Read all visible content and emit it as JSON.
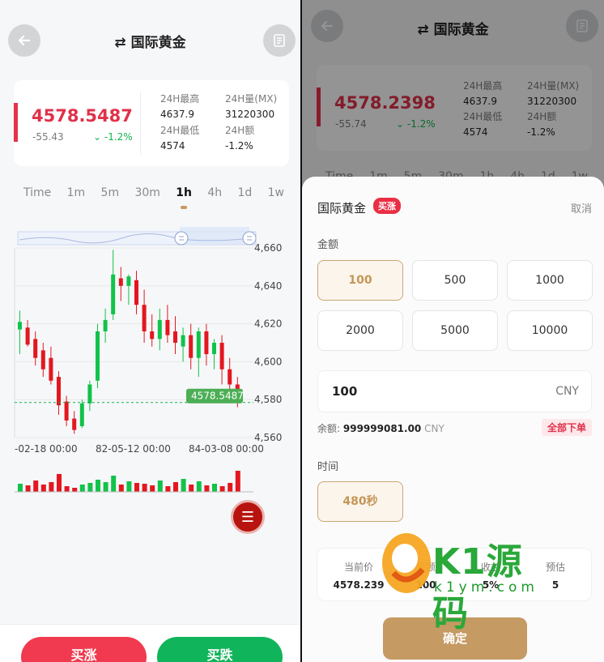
{
  "left": {
    "title": "国际黄金",
    "price": "4578.5487",
    "change": "-55.43",
    "change_pct": "-1.2%",
    "stats": [
      {
        "label": "24H最高",
        "value": "4637.9"
      },
      {
        "label": "24H量(MX)",
        "value": "31220300"
      },
      {
        "label": "24H最低",
        "value": "4574"
      },
      {
        "label": "24H额",
        "value": "-1.2%"
      }
    ],
    "timeframes": [
      "Time",
      "1m",
      "5m",
      "30m",
      "1h",
      "4h",
      "1d",
      "1w"
    ],
    "active_timeframe": "1h",
    "price_axis": [
      "4,660",
      "4,640",
      "4,620",
      "4,600",
      "4,580",
      "4,560"
    ],
    "date_axis": [
      "-02-18 00:00",
      "82-05-12 00:00",
      "84-03-08 00:00"
    ],
    "last_price_tag": "4578.5487",
    "buy_up_label": "买涨",
    "buy_down_label": "买跌"
  },
  "right": {
    "title": "国际黄金",
    "price": "4578.2398",
    "change": "-55.74",
    "change_pct": "-1.2%",
    "stats": [
      {
        "label": "24H最高",
        "value": "4637.9"
      },
      {
        "label": "24H量(MX)",
        "value": "31220300"
      },
      {
        "label": "24H最低",
        "value": "4574"
      },
      {
        "label": "24H额",
        "value": "-1.2%"
      }
    ],
    "timeframes_partial": [
      "Time",
      "1m",
      "5m",
      "30m",
      "1h",
      "4h",
      "1d",
      "1w"
    ]
  },
  "order": {
    "title": "国际黄金",
    "direction_badge": "买涨",
    "cancel_label": "取消",
    "amount_label": "金额",
    "amount_options": [
      "100",
      "500",
      "1000",
      "2000",
      "5000",
      "10000"
    ],
    "selected_amount": "100",
    "amount_input": "100",
    "currency": "CNY",
    "balance_label": "余额:",
    "balance_value": "999999081.00",
    "balance_currency": "CNY",
    "all_in_label": "全部下单",
    "time_label": "时间",
    "time_option": "480秒",
    "summary": [
      {
        "label": "当前价",
        "value": "4578.239"
      },
      {
        "label": "金额",
        "value": "100"
      },
      {
        "label": "收益",
        "value": "5%"
      },
      {
        "label": "预估",
        "value": "5"
      }
    ],
    "confirm_label": "确定"
  },
  "watermark": {
    "text": "K1源码",
    "sub": "k1ym.com"
  },
  "colors": {
    "up": "#12c24a",
    "down": "#e3171f",
    "accent": "#c59a63",
    "price_red": "#e0314a"
  }
}
